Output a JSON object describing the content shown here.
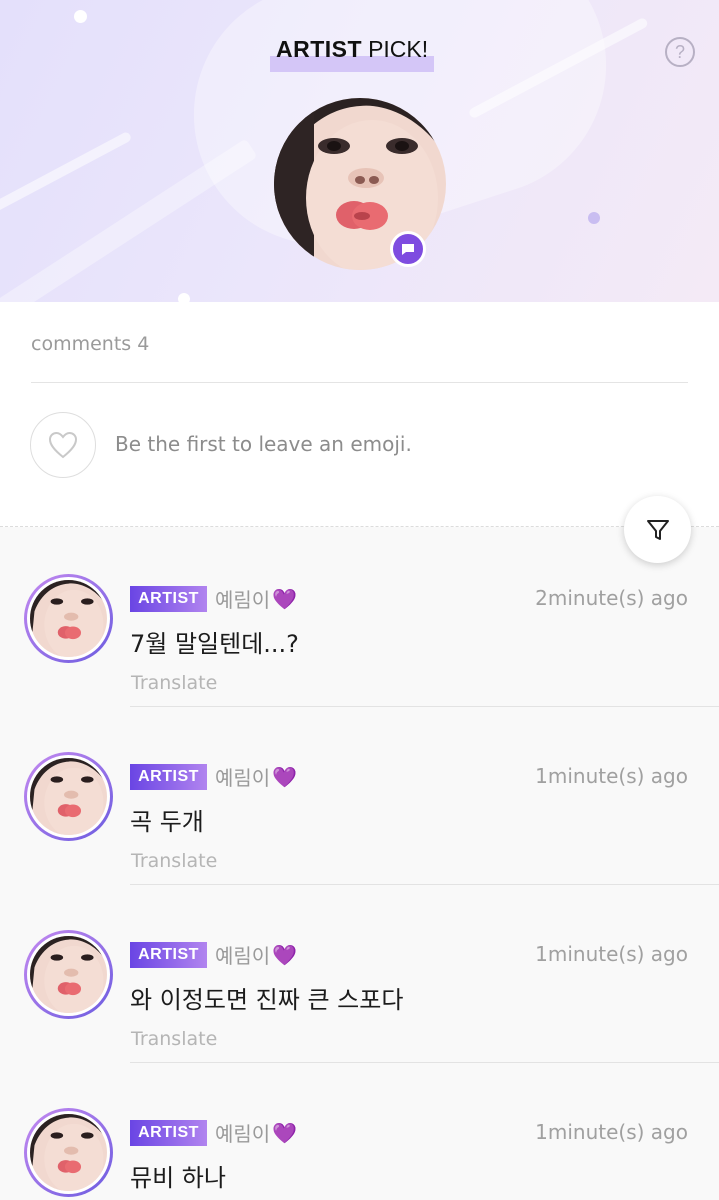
{
  "header": {
    "title_bold": "ARTIST",
    "title_rest": "PICK!",
    "help_icon": "question-icon"
  },
  "emoji_section": {
    "comments_label": "comments 4",
    "placeholder": "Be the first to leave an emoji.",
    "heart_icon": "heart-outline-icon"
  },
  "comments": [
    {
      "badge": "ARTIST",
      "username": "예림이",
      "heart": "💜",
      "time": "2minute(s) ago",
      "text": "7월 말일텐데...?",
      "translate": "Translate"
    },
    {
      "badge": "ARTIST",
      "username": "예림이",
      "heart": "💜",
      "time": "1minute(s) ago",
      "text": "곡 두개",
      "translate": "Translate"
    },
    {
      "badge": "ARTIST",
      "username": "예림이",
      "heart": "💜",
      "time": "1minute(s) ago",
      "text": "와 이정도면 진짜 큰 스포다",
      "translate": "Translate"
    },
    {
      "badge": "ARTIST",
      "username": "예림이",
      "heart": "💜",
      "time": "1minute(s) ago",
      "text": "뮤비 하나",
      "translate": ""
    }
  ],
  "colors": {
    "accent": "#7e4ce0",
    "badge_start": "#6a45e4",
    "badge_end": "#b184ef",
    "header_bg": "#e9e4fb"
  }
}
